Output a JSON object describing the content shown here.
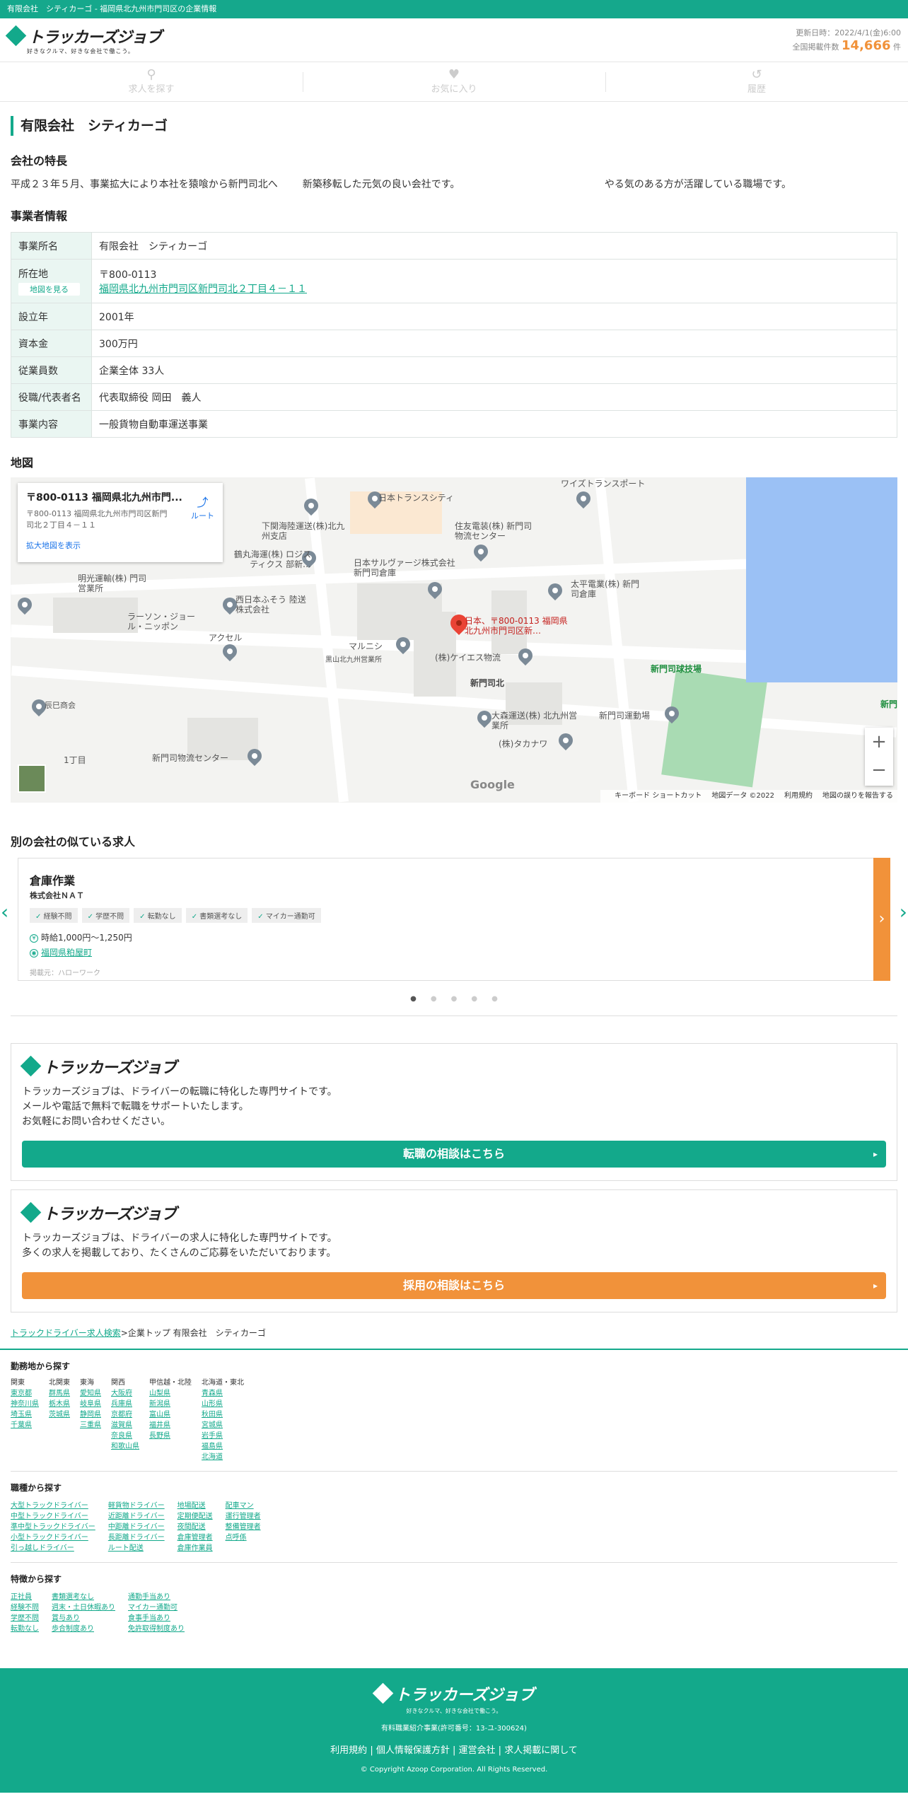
{
  "topbar": {
    "text": "有限会社　シティカーゴ - 福岡県北九州市門司区の企業情報"
  },
  "header": {
    "logo_name": "トラッカーズジョブ",
    "logo_tagline": "好きなクルマ、好きな会社で働こう。",
    "updated": "更新日時：2022/4/1(金)6:00",
    "total_label": "全国掲載件数",
    "total_count": "14,666",
    "total_unit": "件"
  },
  "nav": {
    "search": "求人を探す",
    "favorites": "お気に入り",
    "history": "履歴"
  },
  "company": {
    "name": "有限会社　シティカーゴ"
  },
  "features": {
    "heading": "会社の特長",
    "items": [
      "平成２３年５月、事業拡大により本社を猿喰から新門司北へ",
      "新築移転した元気の良い会社です。",
      "やる気のある方が活躍している職場です。"
    ]
  },
  "business": {
    "heading": "事業者情報",
    "rows": [
      {
        "label": "事業所名",
        "value": "有限会社　シティカーゴ"
      },
      {
        "label": "所在地",
        "button": "地図を見る",
        "zip": "〒800-0113",
        "address": "福岡県北九州市門司区新門司北２丁目４－１１"
      },
      {
        "label": "設立年",
        "value": "2001年"
      },
      {
        "label": "資本金",
        "value": "300万円"
      },
      {
        "label": "従業員数",
        "value": "企業全体 33人"
      },
      {
        "label": "役職/代表者名",
        "value": "代表取締役 岡田　義人"
      },
      {
        "label": "事業内容",
        "value": "一般貨物自動車運送事業"
      }
    ]
  },
  "map": {
    "heading": "地図",
    "info_title": "〒800-0113 福岡県北九州市門...",
    "info_address": "〒800-0113 福岡県北九州市門司区新門司北２丁目４－１１",
    "route": "ルート",
    "enlarge": "拡大地図を表示",
    "marker_label": "日本、〒800-0113 福岡県北九州市門司区新…",
    "labels": [
      "日本トランスシティ",
      "ワイズトランスポート",
      "下関海陸運送(株)北九州支店",
      "住友電装(株) 新門司物流センター",
      "鶴丸海運(株) ロジスティクス 部新…",
      "日本サルヴァージ株式会社 新門司倉庫",
      "太平電業(株) 新門司倉庫",
      "明光運輸(株) 門司営業所",
      "西日本ふそう 陸送株式会社",
      "ラーソン・ジョール・ニッポン",
      "アクセル",
      "マルニシ",
      "黒山北九州営業所",
      "(株)ケイエス物流",
      "新門司球技場",
      "新門司北",
      "新門司運動場",
      "大森運送(株) 北九州営業所",
      "(株)タカナワ",
      "新門司物流センター",
      "辰巳商会",
      "1丁目",
      "新門"
    ],
    "google": "Google",
    "footer": [
      "キーボード ショートカット",
      "地図データ ©2022",
      "利用規約",
      "地図の誤りを報告する"
    ]
  },
  "similar": {
    "heading": "別の会社の似ている求人",
    "job": {
      "title": "倉庫作業",
      "company": "株式会社ＮＡＴ",
      "tags": [
        "経験不問",
        "学歴不問",
        "転勤なし",
        "書類選考なし",
        "マイカー通勤可"
      ],
      "wage": "時給1,000円〜1,250円",
      "location": "福岡県粕屋町",
      "source": "掲載元：ハローワーク"
    }
  },
  "promo1": {
    "logo": "トラッカーズジョブ",
    "text": [
      "トラッカーズジョブは、ドライバーの転職に特化した専門サイトです。",
      "メールや電話で無料で転職をサポートいたします。",
      "お気軽にお問い合わせください。"
    ],
    "button": "転職の相談はこちら"
  },
  "promo2": {
    "logo": "トラッカーズジョブ",
    "text": [
      "トラッカーズジョブは、ドライバーの求人に特化した専門サイトです。",
      "多くの求人を掲載しており、たくさんのご応募をいただいております。"
    ],
    "button": "採用の相談はこちら"
  },
  "breadcrumb": {
    "link": "トラックドライバー求人検索",
    "sep": ">",
    "current": "企業トップ 有限会社　シティカーゴ"
  },
  "area": {
    "heading": "勤務地から探す",
    "regions": [
      {
        "name": "関東",
        "items": [
          "東京都",
          "神奈川県",
          "埼玉県",
          "千葉県"
        ]
      },
      {
        "name": "北関東",
        "items": [
          "群馬県",
          "栃木県",
          "茨城県"
        ]
      },
      {
        "name": "東海",
        "items": [
          "愛知県",
          "岐阜県",
          "静岡県",
          "三重県"
        ]
      },
      {
        "name": "関西",
        "items": [
          "大阪府",
          "兵庫県",
          "京都府",
          "滋賀県",
          "奈良県",
          "和歌山県"
        ]
      },
      {
        "name": "甲信越・北陸",
        "items": [
          "山梨県",
          "新潟県",
          "富山県",
          "福井県",
          "長野県"
        ]
      },
      {
        "name": "北海道・東北",
        "items": [
          "青森県",
          "山形県",
          "秋田県",
          "宮城県",
          "岩手県",
          "福島県",
          "北海道"
        ]
      }
    ]
  },
  "jobtype": {
    "heading": "職種から探す",
    "cols": [
      [
        "大型トラックドライバー",
        "中型トラックドライバー",
        "準中型トラックドライバー",
        "小型トラックドライバー",
        "引っ越しドライバー"
      ],
      [
        "軽貨物ドライバー",
        "近距離ドライバー",
        "中距離ドライバー",
        "長距離ドライバー",
        "ルート配送"
      ],
      [
        "地場配送",
        "定期便配送",
        "夜間配送",
        "倉庫管理者",
        "倉庫作業員"
      ],
      [
        "配車マン",
        "運行管理者",
        "整備管理者",
        "点呼係"
      ]
    ]
  },
  "features_search": {
    "heading": "特徴から探す",
    "cols": [
      [
        "正社員",
        "経験不問",
        "学歴不問",
        "転勤なし"
      ],
      [
        "書類選考なし",
        "週末・土日休暇あり",
        "賞与あり",
        "歩合制度あり"
      ],
      [
        "通勤手当あり",
        "マイカー通勤可",
        "食事手当あり",
        "免許取得制度あり"
      ]
    ]
  },
  "footer": {
    "logo": "トラッカーズジョブ",
    "tagline": "好きなクルマ、好きな会社で働こう。",
    "license": "有料職業紹介事業(許可番号：13-ユ-300624)",
    "links": [
      "利用規約",
      "個人情報保護方針",
      "運営会社",
      "求人掲載に関して"
    ],
    "copyright": "© Copyright Azoop Corporation. All Rights Reserved."
  },
  "colors": {
    "primary": "#13a98b",
    "accent": "#f1923a"
  }
}
